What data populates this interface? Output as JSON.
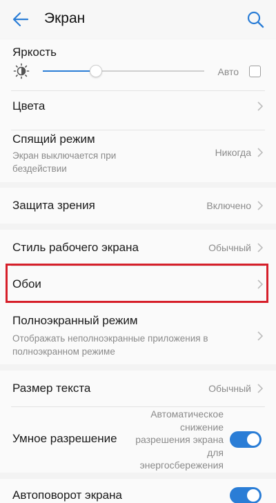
{
  "header": {
    "title": "Экран"
  },
  "brightness": {
    "label": "Яркость",
    "auto_label": "Авто",
    "level": 0.33,
    "auto_checked": false
  },
  "settings": {
    "colors": {
      "label": "Цвета"
    },
    "sleep": {
      "label": "Спящий режим",
      "sub": "Экран выключается при бездействии",
      "value": "Никогда"
    },
    "eye_protection": {
      "label": "Защита зрения",
      "value": "Включено"
    },
    "home_style": {
      "label": "Стиль рабочего экрана",
      "value": "Обычный"
    },
    "wallpaper": {
      "label": "Обои"
    },
    "fullscreen": {
      "label": "Полноэкранный режим",
      "sub": "Отображать неполноэкранные приложения в полноэкранном режиме"
    },
    "text_size": {
      "label": "Размер текста",
      "value": "Обычный"
    },
    "smart_resolution": {
      "label": "Умное разрешение",
      "value": "Автоматическое снижение разрешения экрана для энергосбережения",
      "enabled": true
    },
    "auto_rotate": {
      "label": "Автоповорот экрана",
      "enabled": true
    }
  },
  "colors": {
    "accent": "#2a7dd6",
    "highlight": "#d61f2a"
  },
  "icons": [
    "back-arrow-icon",
    "search-icon",
    "brightness-icon",
    "chevron-right-icon"
  ]
}
